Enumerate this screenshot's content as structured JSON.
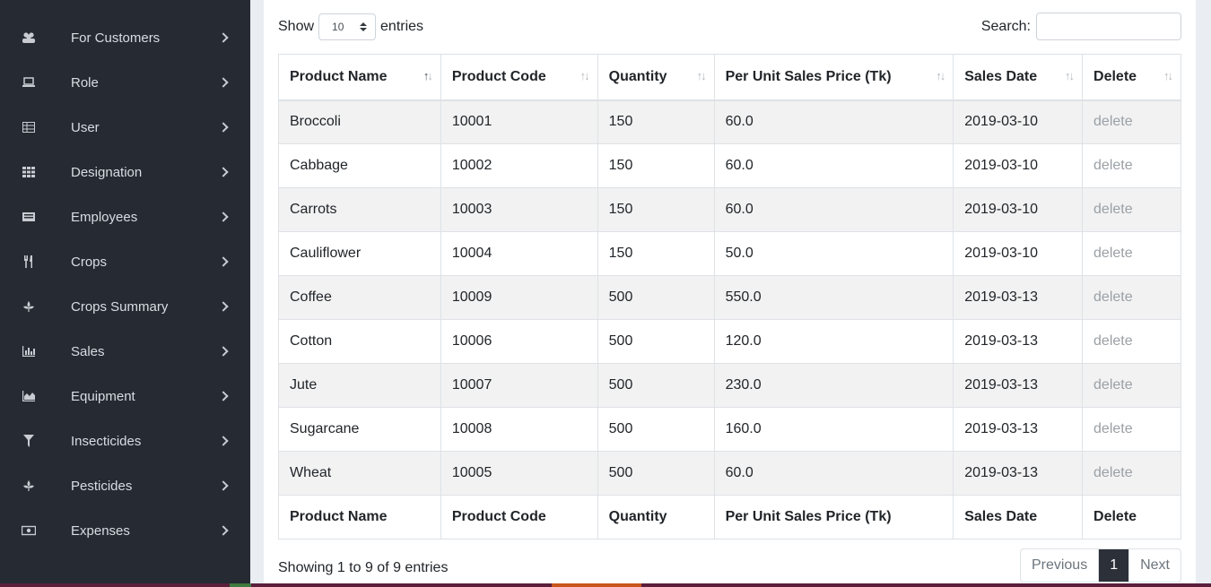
{
  "sidebar": {
    "items": [
      {
        "label": "For Customers",
        "icon": "users-icon"
      },
      {
        "label": "Role",
        "icon": "laptop-icon"
      },
      {
        "label": "User",
        "icon": "table-icon"
      },
      {
        "label": "Designation",
        "icon": "grid-icon"
      },
      {
        "label": "Employees",
        "icon": "id-card-icon"
      },
      {
        "label": "Crops",
        "icon": "utensils-icon"
      },
      {
        "label": "Crops Summary",
        "icon": "leaf-icon"
      },
      {
        "label": "Sales",
        "icon": "bar-chart-icon"
      },
      {
        "label": "Equipment",
        "icon": "area-chart-icon"
      },
      {
        "label": "Insecticides",
        "icon": "filter-icon"
      },
      {
        "label": "Pesticides",
        "icon": "leaf-icon"
      },
      {
        "label": "Expenses",
        "icon": "money-icon"
      }
    ]
  },
  "controls": {
    "show_label": "Show",
    "entries_value": "10",
    "entries_label": "entries",
    "search_label": "Search:",
    "search_value": ""
  },
  "table": {
    "headers": [
      "Product Name",
      "Product Code",
      "Quantity",
      "Per Unit Sales Price (Tk)",
      "Sales Date",
      "Delete"
    ],
    "rows": [
      [
        "Broccoli",
        "10001",
        "150",
        "60.0",
        "2019-03-10",
        "delete"
      ],
      [
        "Cabbage",
        "10002",
        "150",
        "60.0",
        "2019-03-10",
        "delete"
      ],
      [
        "Carrots",
        "10003",
        "150",
        "60.0",
        "2019-03-10",
        "delete"
      ],
      [
        "Cauliflower",
        "10004",
        "150",
        "50.0",
        "2019-03-10",
        "delete"
      ],
      [
        "Coffee",
        "10009",
        "500",
        "550.0",
        "2019-03-13",
        "delete"
      ],
      [
        "Cotton",
        "10006",
        "500",
        "120.0",
        "2019-03-13",
        "delete"
      ],
      [
        "Jute",
        "10007",
        "500",
        "230.0",
        "2019-03-13",
        "delete"
      ],
      [
        "Sugarcane",
        "10008",
        "500",
        "160.0",
        "2019-03-13",
        "delete"
      ],
      [
        "Wheat",
        "10005",
        "500",
        "60.0",
        "2019-03-13",
        "delete"
      ]
    ]
  },
  "footer": {
    "info": "Showing 1 to 9 of 9 entries",
    "previous": "Previous",
    "current_page": "1",
    "next": "Next"
  },
  "colors": {
    "sidebar_bg": "#252a33",
    "active_page_bg": "#2b3039"
  }
}
